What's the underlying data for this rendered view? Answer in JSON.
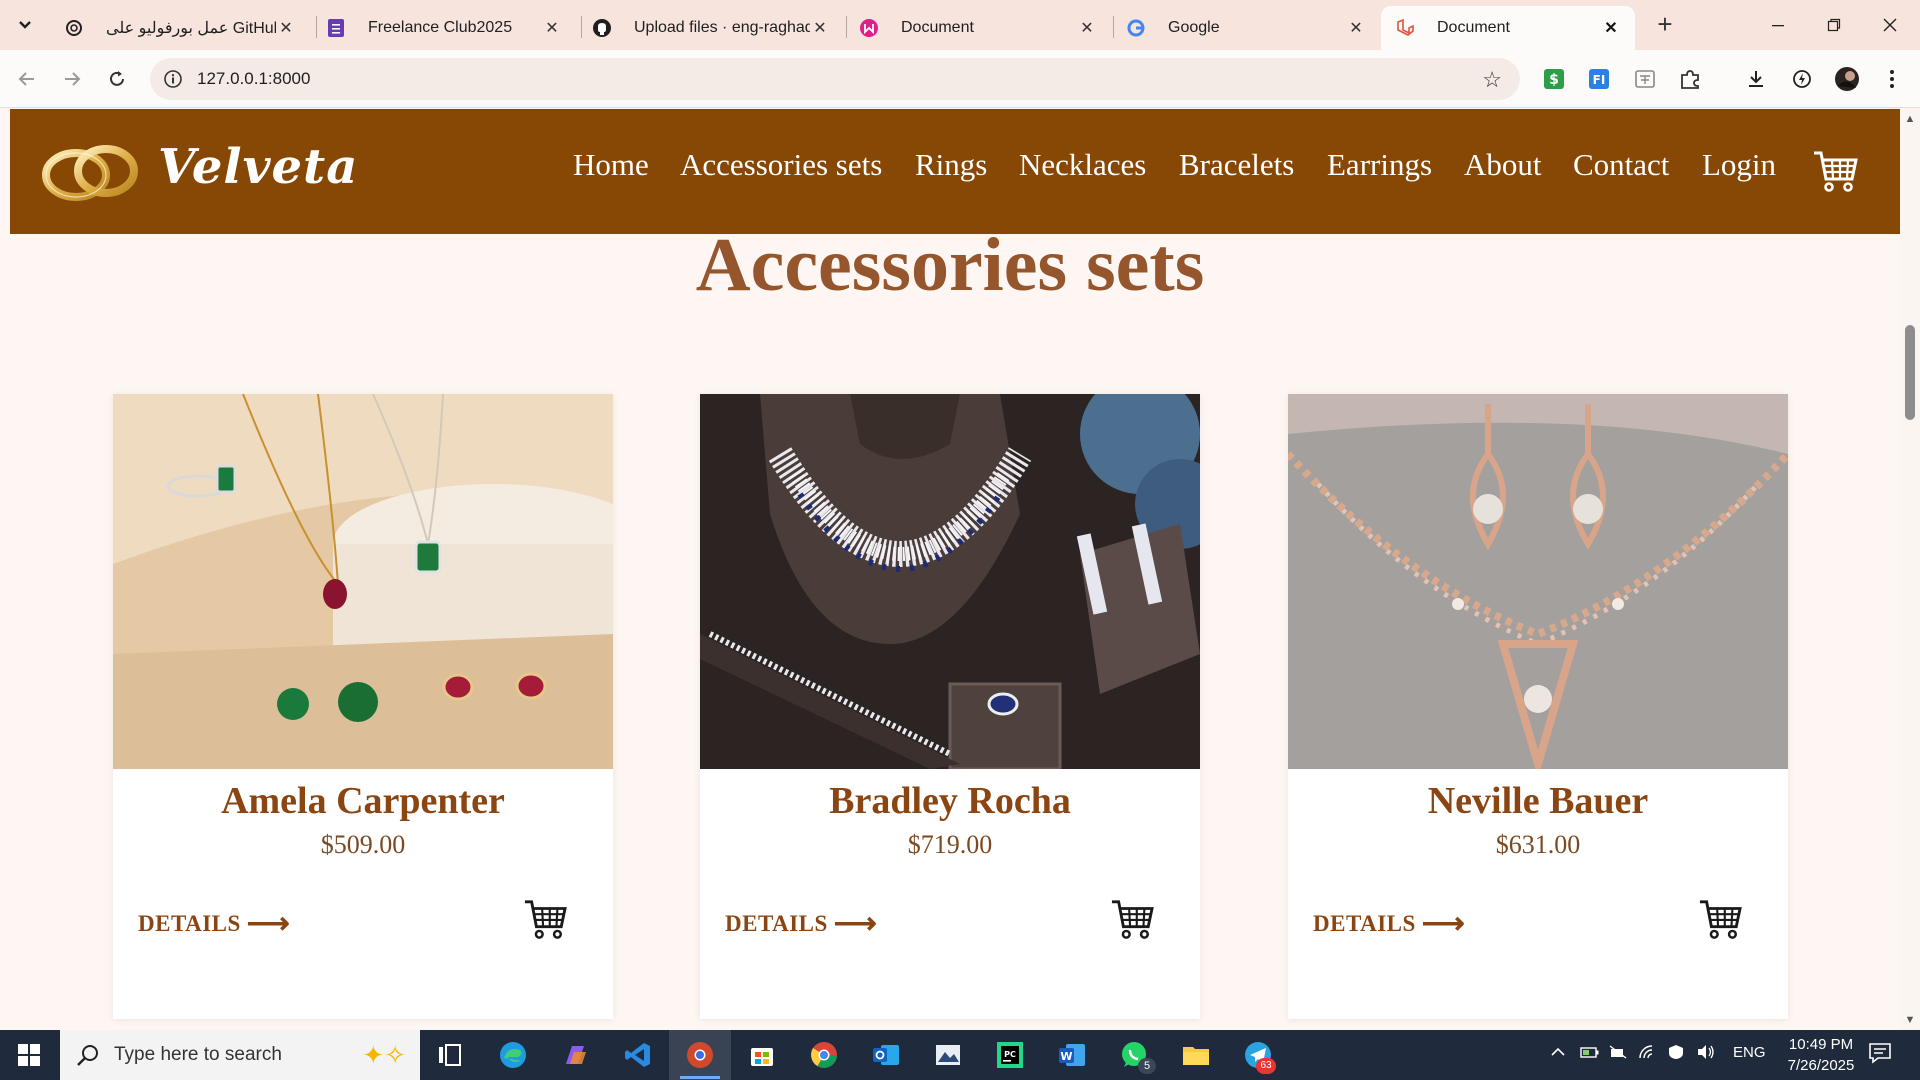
{
  "browser": {
    "tabs": [
      {
        "title": "عمل بورفوليو على GitHub",
        "active": false
      },
      {
        "title": "Freelance Club2025",
        "active": false
      },
      {
        "title": "Upload files · eng-raghads",
        "active": false
      },
      {
        "title": "Document",
        "active": false
      },
      {
        "title": "Google",
        "active": false
      },
      {
        "title": "Document",
        "active": true
      }
    ],
    "url": "127.0.0.1:8000"
  },
  "site": {
    "brand": "Velveta",
    "nav": [
      "Home",
      "Accessories sets",
      "Rings",
      "Necklaces",
      "Bracelets",
      "Earrings",
      "About",
      "Contact",
      "Login"
    ],
    "section_title": "Accessories sets",
    "products": [
      {
        "name": "Amela Carpenter",
        "price": "$509.00",
        "details": "DETAILS"
      },
      {
        "name": "Bradley Rocha",
        "price": "$719.00",
        "details": "DETAILS"
      },
      {
        "name": "Neville Bauer",
        "price": "$631.00",
        "details": "DETAILS"
      }
    ],
    "colors": {
      "header": "#874805",
      "accent": "#95552d",
      "page_bg": "#fdf6f2"
    }
  },
  "taskbar": {
    "search_placeholder": "Type here to search",
    "language": "ENG",
    "time": "10:49 PM",
    "date": "7/26/2025",
    "badges": {
      "whatsapp": "5",
      "telegram": "63"
    }
  }
}
